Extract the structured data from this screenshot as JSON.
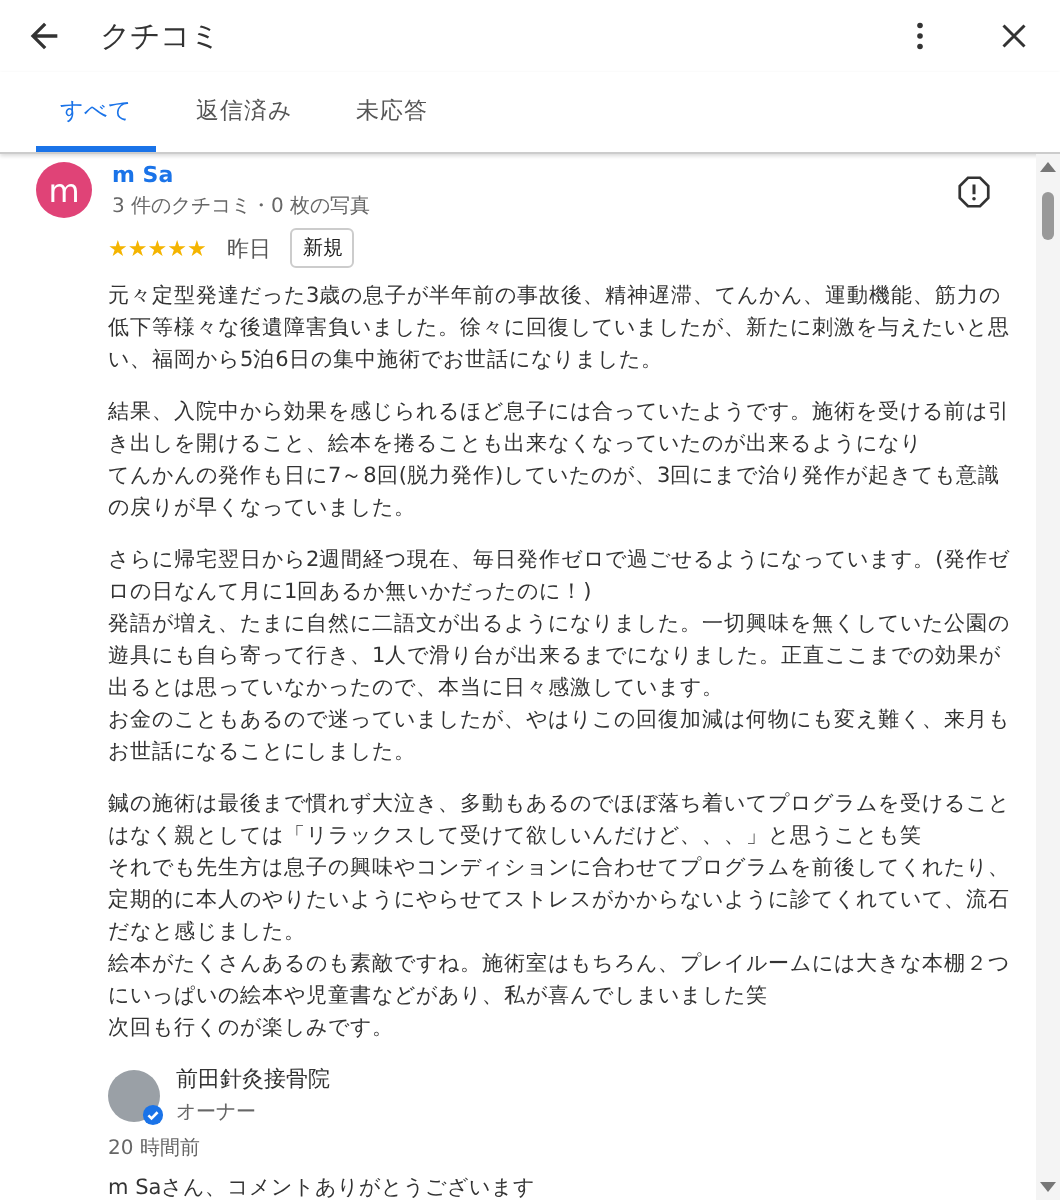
{
  "header": {
    "title": "クチコミ"
  },
  "tabs": [
    {
      "label": "すべて",
      "selected": true
    },
    {
      "label": "返信済み",
      "selected": false
    },
    {
      "label": "未応答",
      "selected": false
    }
  ],
  "review": {
    "author": "m Sa",
    "avatar_letter": "m",
    "meta": "3 件のクチコミ・0 枚の写真",
    "stars": 5,
    "date": "昨日",
    "badge": "新規",
    "paragraphs": [
      [
        "元々定型発達だった3歳の息子が半年前の事故後、精神遅滞、てんかん、運動機能、筋力の低下等様々な後遺障害負いました。徐々に回復していましたが、新たに刺激を与えたいと思い、福岡から5泊6日の集中施術でお世話になりました。"
      ],
      [
        "結果、入院中から効果を感じられるほど息子には合っていたようです。施術を受ける前は引き出しを開けること、絵本を捲ることも出来なくなっていたのが出来るようになり",
        "てんかんの発作も日に7～8回(脱力発作)していたのが、3回にまで治り発作が起きても意識の戻りが早くなっていました。"
      ],
      [
        "さらに帰宅翌日から2週間経つ現在、毎日発作ゼロで過ごせるようになっています。(発作ゼロの日なんて月に1回あるか無いかだったのに！)",
        "発語が増え、たまに自然に二語文が出るようになりました。一切興味を無くしていた公園の遊具にも自ら寄って行き、1人で滑り台が出来るまでになりました。正直ここまでの効果が出るとは思っていなかったので、本当に日々感激しています。",
        "お金のこともあるので迷っていましたが、やはりこの回復加減は何物にも変え難く、来月もお世話になることにしました。"
      ],
      [
        "鍼の施術は最後まで慣れず大泣き、多動もあるのでほぼ落ち着いてプログラムを受けることはなく親としては「リラックスして受けて欲しいんだけど、、、」と思うことも笑",
        "それでも先生方は息子の興味やコンディションに合わせてプログラムを前後してくれたり、定期的に本人のやりたいようにやらせてストレスがかからないように診てくれていて、流石だなと感じました。",
        "絵本がたくさんあるのも素敵ですね。施術室はもちろん、プレイルームには大きな本棚２つにいっぱいの絵本や児童書などがあり、私が喜んでしまいました笑",
        "次回も行くのが楽しみです。"
      ]
    ]
  },
  "reply": {
    "name": "前田針灸接骨院",
    "role": "オーナー",
    "time": "20 時間前",
    "text": "m Saさん、コメントありがとうございます"
  }
}
